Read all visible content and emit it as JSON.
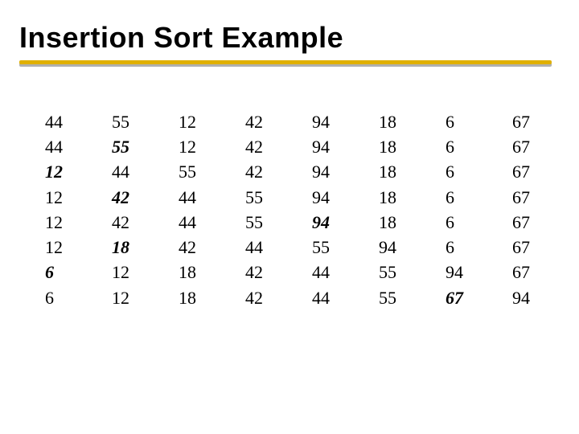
{
  "slide": {
    "title": "Insertion Sort Example"
  },
  "chart_data": {
    "type": "table",
    "title": "Insertion Sort Example",
    "description": "Eight columns showing successive states of an array during insertion sort. Bold cells mark the element being inserted or its new position at each step.",
    "columns": [
      {
        "values": [
          44,
          44,
          12,
          12,
          12,
          12,
          6,
          6
        ],
        "bold_rows": [
          2,
          6
        ]
      },
      {
        "values": [
          55,
          55,
          44,
          42,
          42,
          18,
          12,
          12
        ],
        "bold_rows": [
          1,
          3,
          5
        ]
      },
      {
        "values": [
          12,
          12,
          55,
          44,
          44,
          42,
          18,
          18
        ],
        "bold_rows": []
      },
      {
        "values": [
          42,
          42,
          42,
          55,
          55,
          44,
          42,
          42
        ],
        "bold_rows": []
      },
      {
        "values": [
          94,
          94,
          94,
          94,
          94,
          55,
          44,
          44
        ],
        "bold_rows": [
          4
        ]
      },
      {
        "values": [
          18,
          18,
          18,
          18,
          18,
          94,
          55,
          55
        ],
        "bold_rows": []
      },
      {
        "values": [
          6,
          6,
          6,
          6,
          6,
          6,
          94,
          67
        ],
        "bold_rows": [
          7
        ]
      },
      {
        "values": [
          67,
          67,
          67,
          67,
          67,
          67,
          67,
          94
        ],
        "bold_rows": []
      }
    ],
    "rows": 8,
    "cols": 8
  }
}
